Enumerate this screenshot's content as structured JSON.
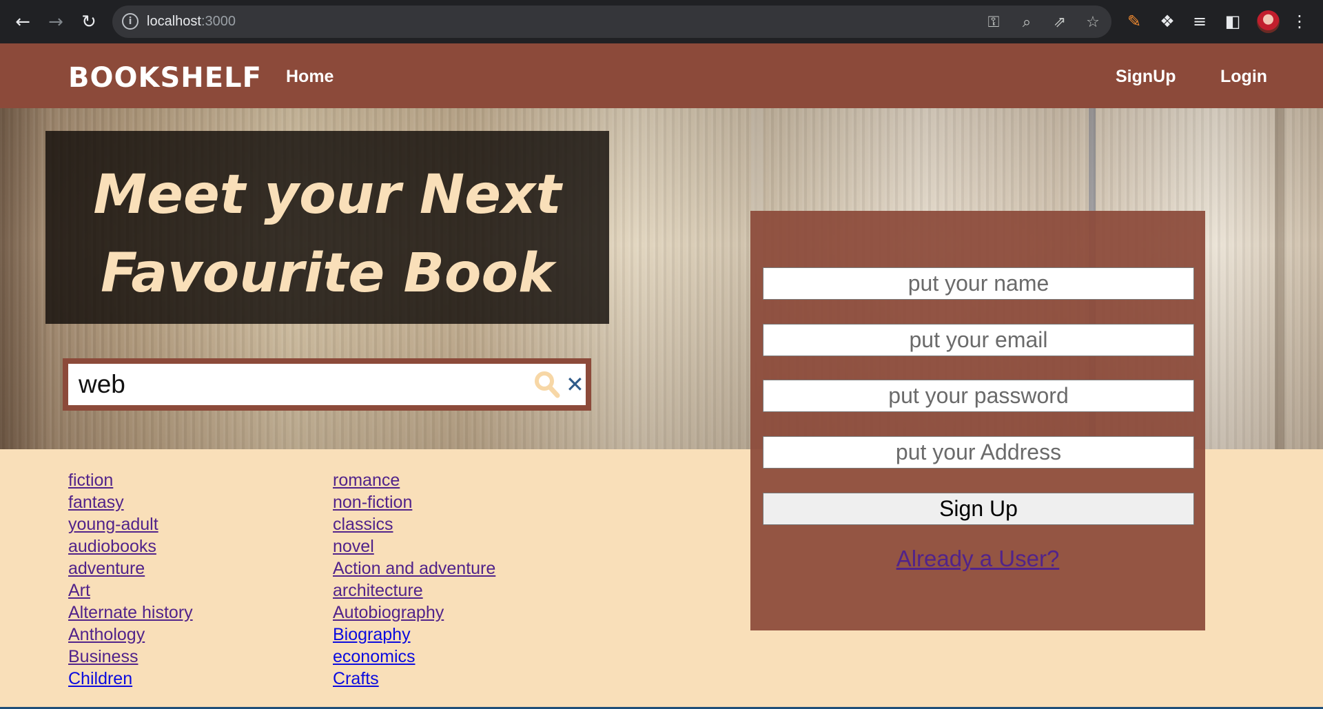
{
  "browser": {
    "url_host": "localhost",
    "url_port": ":3000",
    "icons": {
      "back": "back-arrow-icon",
      "forward": "forward-arrow-icon",
      "reload": "reload-icon",
      "info": "site-info-icon",
      "key": "password-key-icon",
      "zoom": "zoom-icon",
      "share": "share-icon",
      "star": "bookmark-star-icon",
      "pen": "pen-extension-icon",
      "puzzle": "extensions-puzzle-icon",
      "media": "media-queue-icon",
      "sidepanel": "side-panel-icon",
      "menu": "kebab-menu-icon"
    }
  },
  "header": {
    "brand": "BOOKSHELF",
    "home": "Home",
    "signup": "SignUp",
    "login": "Login"
  },
  "hero": {
    "tagline_line1": "Meet your Next",
    "tagline_line2": "Favourite Book"
  },
  "search": {
    "value": "web",
    "clear_symbol": "✕"
  },
  "categories": {
    "left": [
      "fiction",
      "fantasy",
      "young-adult",
      "audiobooks",
      "adventure",
      "Art",
      "Alternate history",
      "Anthology",
      "Business",
      "Children"
    ],
    "right": [
      "romance",
      "non-fiction",
      "classics",
      "novel",
      "Action and adventure",
      "architecture",
      "Autobiography",
      "Biography",
      "economics",
      "Crafts"
    ]
  },
  "signup_form": {
    "name_placeholder": "put your name",
    "email_placeholder": "put your email",
    "password_placeholder": "put your password",
    "address_placeholder": "put your Address",
    "submit_label": "Sign Up",
    "already_user": "Already a User?"
  },
  "colors": {
    "brand_brown": "#8c4a3a",
    "page_bg": "#f9dfb9",
    "tagline_text": "#f9dfb9",
    "visited_link": "#51238a",
    "unvisited_link": "#0b0bde"
  }
}
